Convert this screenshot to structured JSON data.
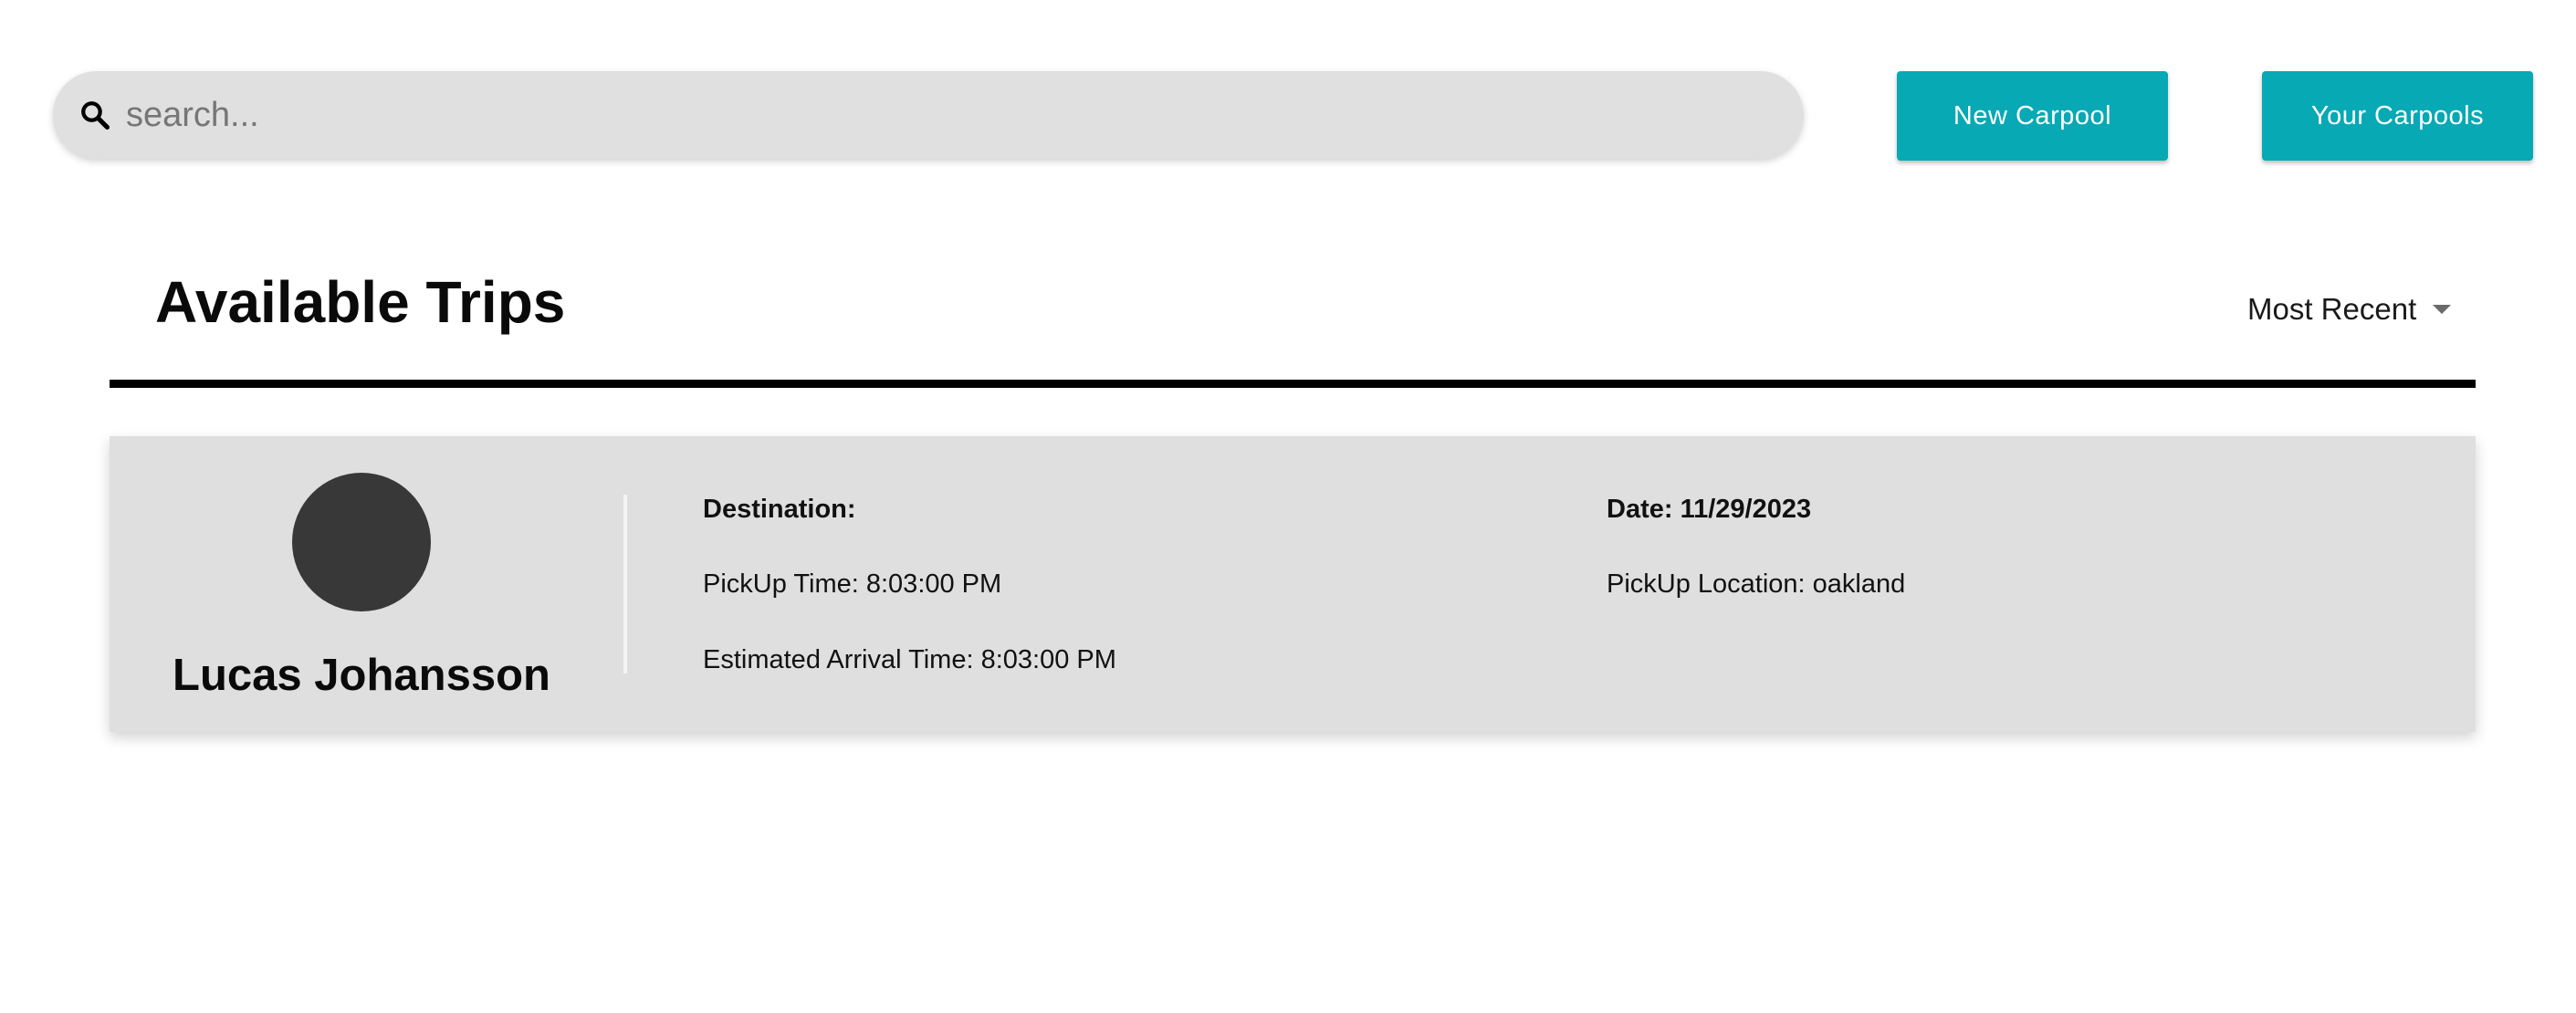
{
  "search": {
    "placeholder": "search...",
    "icon": "search-icon"
  },
  "actions": {
    "new_carpool": "New Carpool",
    "your_carpools": "Your Carpools"
  },
  "colors": {
    "accent": "#06a9b4",
    "card_bg": "#dfdfdf",
    "search_bg": "#e0e0e0",
    "avatar": "#383838"
  },
  "page": {
    "title": "Available Trips",
    "sort": {
      "selected": "Most Recent"
    }
  },
  "trips": [
    {
      "driver_name": "Lucas Johansson",
      "destination_label": "Destination:",
      "pickup_time": "PickUp Time: 8:03:00 PM",
      "arrival_time": "Estimated Arrival Time: 8:03:00 PM",
      "date": "Date: 11/29/2023",
      "pickup_location": "PickUp Location: oakland"
    }
  ]
}
